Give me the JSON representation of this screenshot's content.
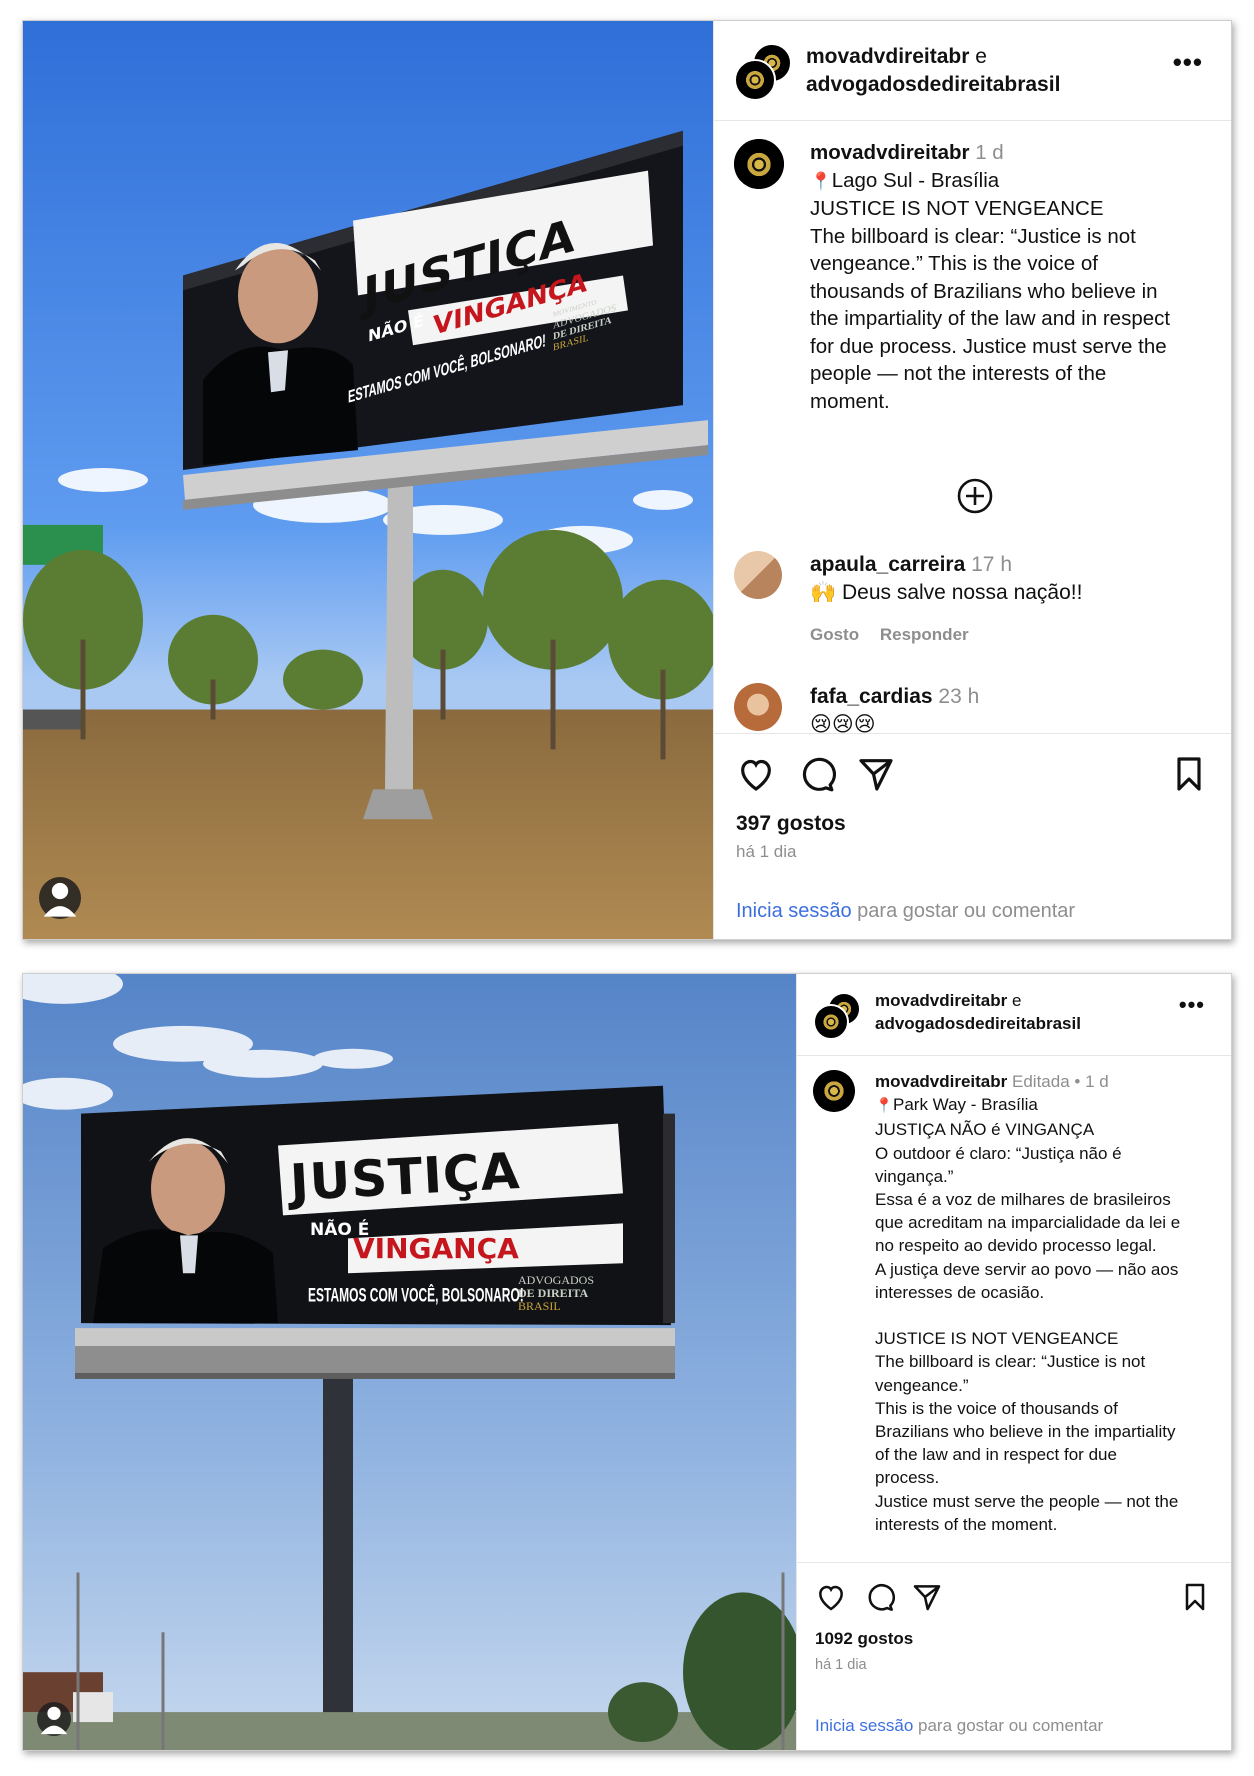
{
  "posts": [
    {
      "header": {
        "user1": "movadvdireitabr",
        "conjunction": "e",
        "user2": "advogadosdedireitabrasil"
      },
      "caption": {
        "username": "movadvdireitabr",
        "edited": "",
        "time": "1 d",
        "location": "Lago Sul - Brasília",
        "lines": [
          "JUSTICE IS NOT VENGEANCE",
          "The billboard is clear: “Justice is not",
          "vengeance.” This is the voice of",
          "thousands of Brazilians who believe in",
          "the impartiality of the law and in respect",
          "for due process. Justice must serve the",
          "people — not the interests of the",
          "moment."
        ]
      },
      "comments": [
        {
          "username": "apaula_carreira",
          "time": "17 h",
          "text": "🙌 Deus salve nossa nação!!",
          "like_label": "Gosto",
          "reply_label": "Responder"
        },
        {
          "username": "fafa_cardias",
          "time": "23 h",
          "text": "😢😢😢"
        }
      ],
      "likes": "397 gostos",
      "when": "há 1 dia",
      "login_link": "Inicia sessão",
      "login_rest": " para gostar ou comentar",
      "billboard": {
        "line1": "JUSTIÇA",
        "line2": "NÃO É",
        "line3": "VINGANÇA",
        "tagline": "ESTAMOS COM VOCÊ, BOLSONARO!",
        "logo_small": "MOVIMENTO",
        "logo1": "ADVOGADOS",
        "logo2": "DE DIREITA",
        "logo3": "BRASIL"
      }
    },
    {
      "header": {
        "user1": "movadvdireitabr",
        "conjunction": "e",
        "user2": "advogadosdedireitabrasil"
      },
      "caption": {
        "username": "movadvdireitabr",
        "edited": "Editada •",
        "time": "1 d",
        "location": "Park Way - Brasília",
        "lines": [
          "JUSTIÇA NÃO é VINGANÇA",
          "O outdoor é claro: “Justiça não é",
          "vingança.”",
          "Essa é a voz de milhares de brasileiros",
          "que acreditam na imparcialidade da lei e",
          "no respeito ao devido processo legal.",
          "A justiça deve servir ao povo — não aos",
          "interesses de ocasião.",
          " ",
          "JUSTICE IS NOT VENGEANCE",
          "The billboard is clear: “Justice is not",
          "vengeance.”",
          "This is the voice of thousands of",
          "Brazilians who believe in the impartiality",
          "of the law and in respect for due",
          "process.",
          "Justice must serve the people — not the",
          "interests of the moment."
        ]
      },
      "likes": "1092 gostos",
      "when": "há 1 dia",
      "login_link": "Inicia sessão",
      "login_rest": " para gostar ou comentar",
      "billboard": {
        "line1": "JUSTIÇA",
        "line2": "NÃO É",
        "line3": "VINGANÇA",
        "tagline": "ESTAMOS COM VOCÊ, BOLSONARO!",
        "logo1": "ADVOGADOS",
        "logo2": "DE DIREITA",
        "logo3": "BRASIL"
      }
    }
  ],
  "colors": {
    "link": "#3d6fe0",
    "meta": "#8e8e8e",
    "billboard_red": "#c4161c"
  },
  "icons": [
    "heart-icon",
    "comment-icon",
    "share-icon",
    "bookmark-icon",
    "more-icon",
    "add-circle-icon",
    "user-tag-icon",
    "location-pin-icon"
  ]
}
